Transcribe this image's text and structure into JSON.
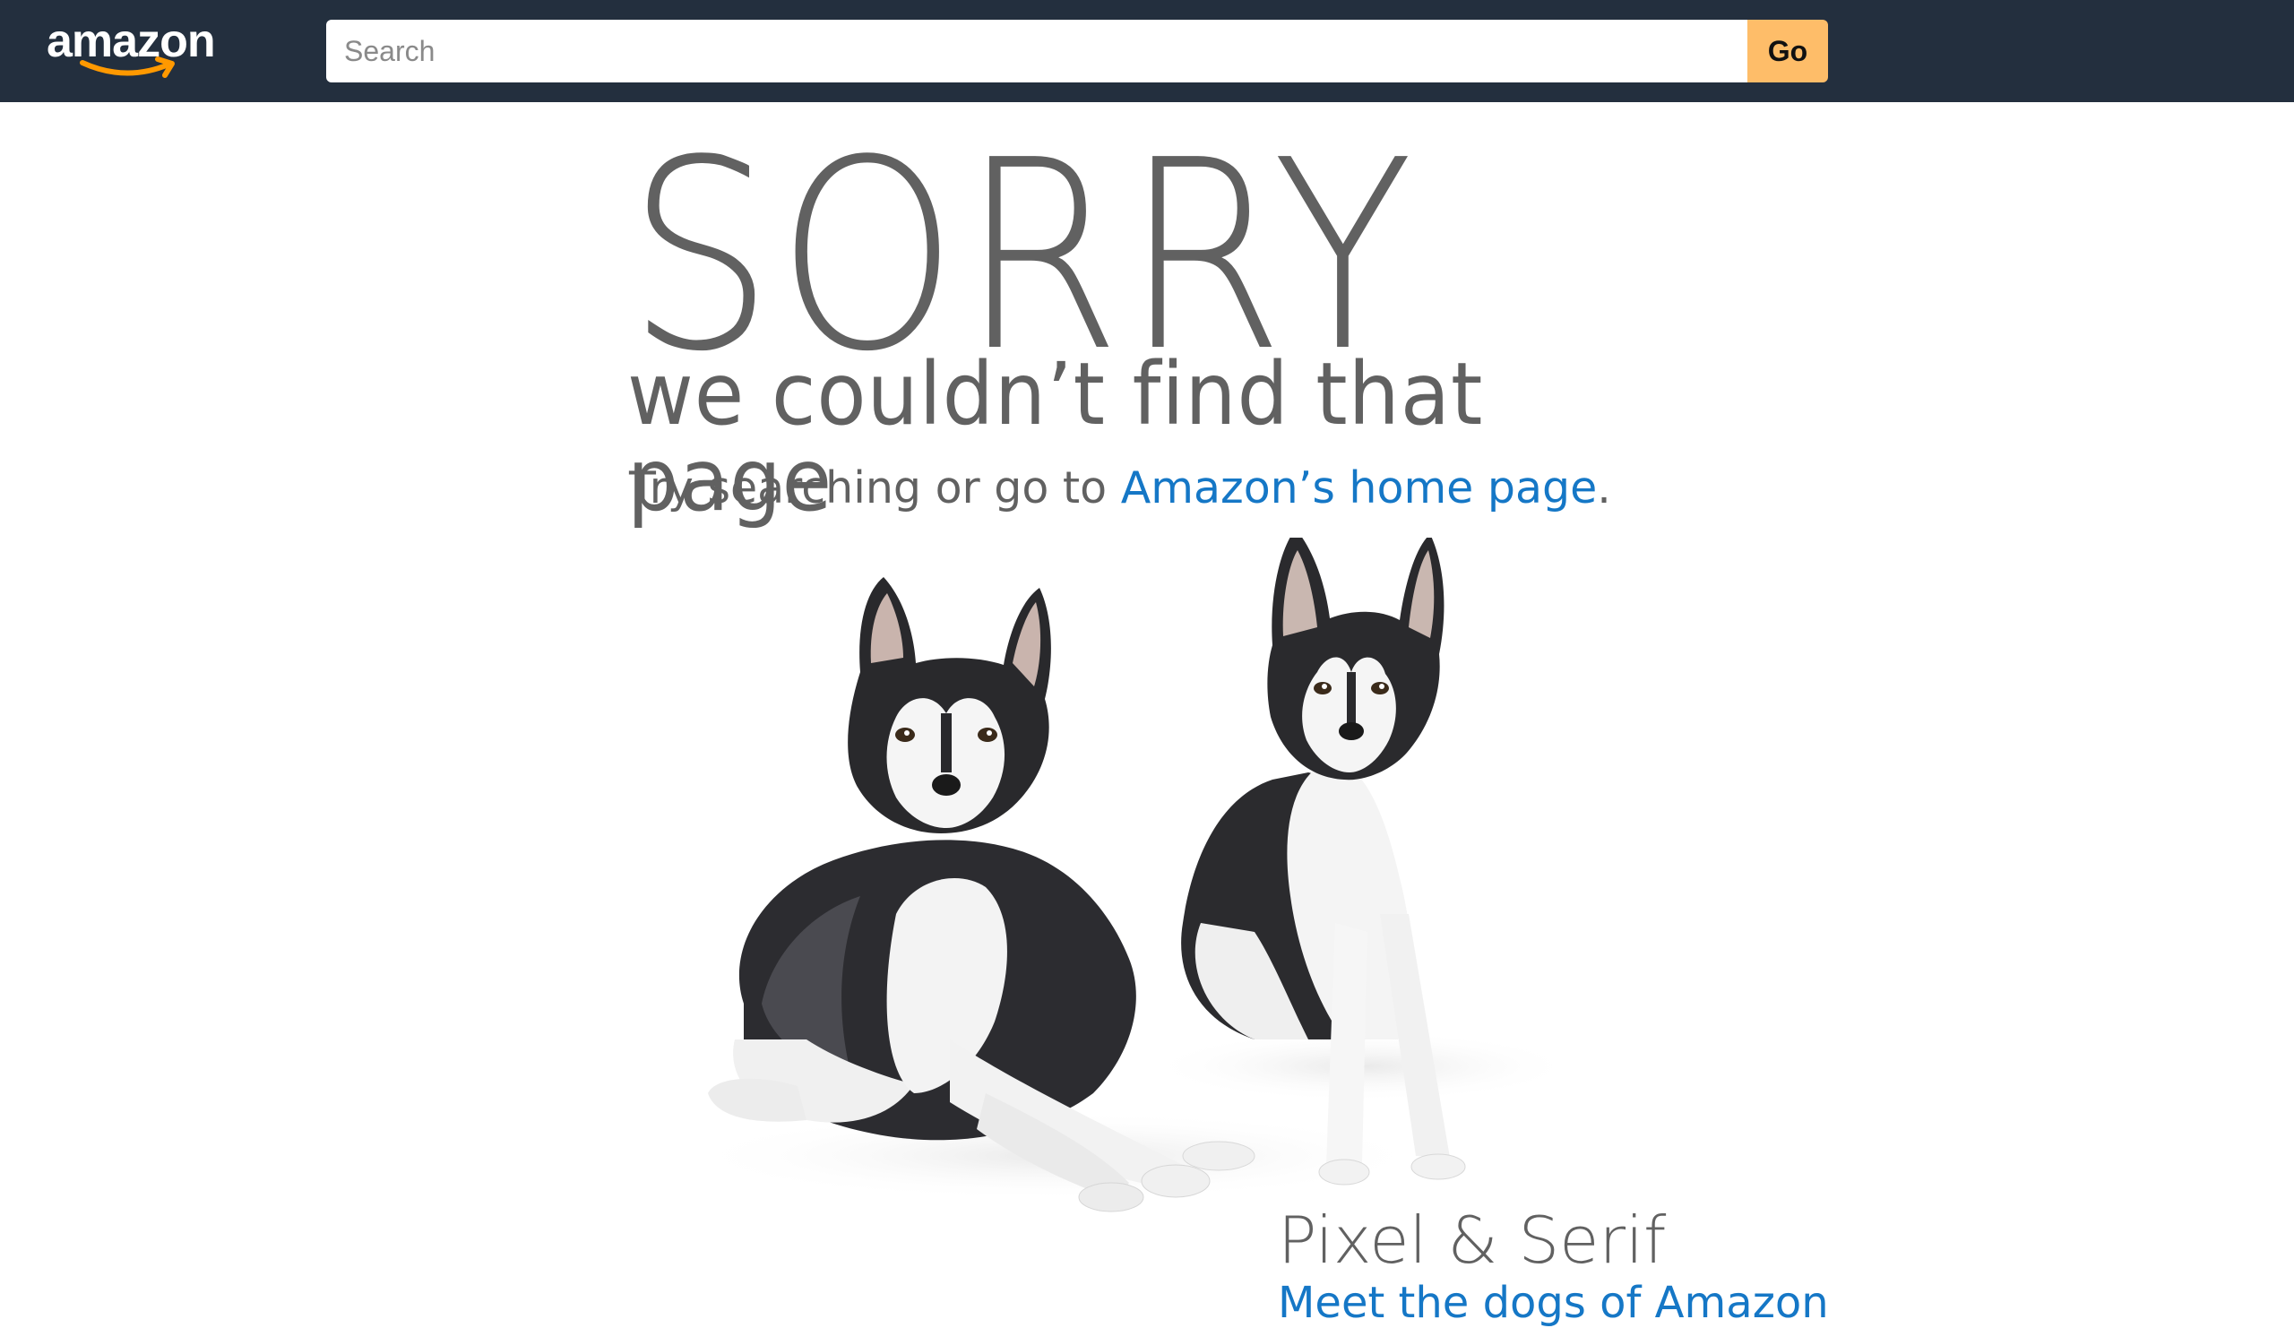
{
  "header": {
    "logo_text": "amazon",
    "search_placeholder": "Search",
    "go_label": "Go"
  },
  "main": {
    "headline": "SORRY",
    "subtitle": "we couldn’t find that page",
    "try_prefix": "Try searching or go to ",
    "home_link": "Amazon’s home page",
    "try_suffix": ".",
    "dog_caption": "Pixel & Serif",
    "dog_caption_link": "Meet the dogs of Amazon"
  },
  "colors": {
    "topbar": "#232f3e",
    "go_button": "#febd69",
    "link": "#1577c6",
    "text": "#616161"
  }
}
